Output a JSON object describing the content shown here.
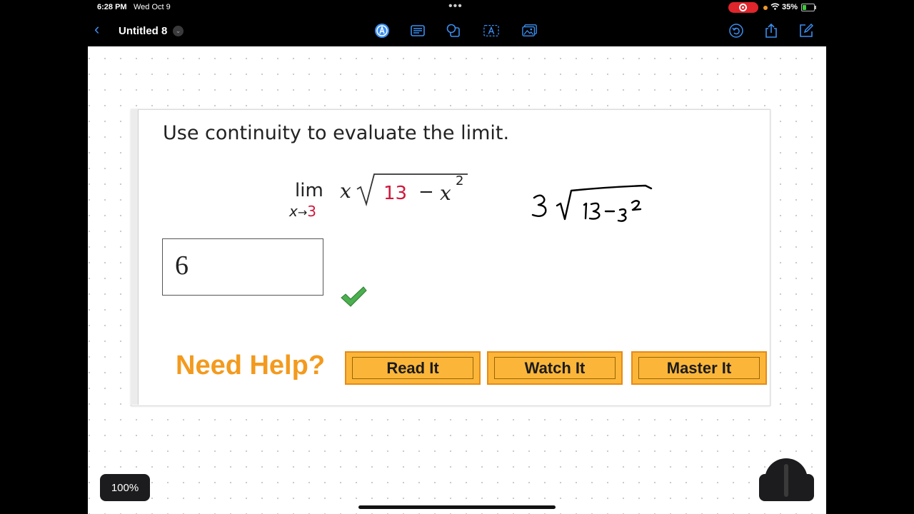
{
  "status": {
    "time": "6:28 PM",
    "date": "Wed Oct 9",
    "battery": "35%",
    "battery_level": 0.35
  },
  "toolbar": {
    "doc_title": "Untitled 8"
  },
  "question": {
    "prompt": "Use continuity to evaluate the limit.",
    "lim_word": "lim",
    "lim_variable": "x",
    "lim_arrow": "→",
    "lim_target": "3",
    "factor": "x",
    "radicand_number": "13",
    "radicand_minus": "−",
    "radicand_var": "x",
    "radicand_exponent": "2"
  },
  "answer": {
    "value": "6"
  },
  "help": {
    "label": "Need Help?",
    "buttons": [
      "Read It",
      "Watch It",
      "Master It"
    ]
  },
  "zoom": {
    "level": "100%"
  },
  "colors": {
    "accent_blue": "#3b8ef0",
    "red_value": "#d0183c",
    "help_orange": "#f39a1e",
    "button_fill": "#fbb63a",
    "check_green": "#4caf50"
  }
}
